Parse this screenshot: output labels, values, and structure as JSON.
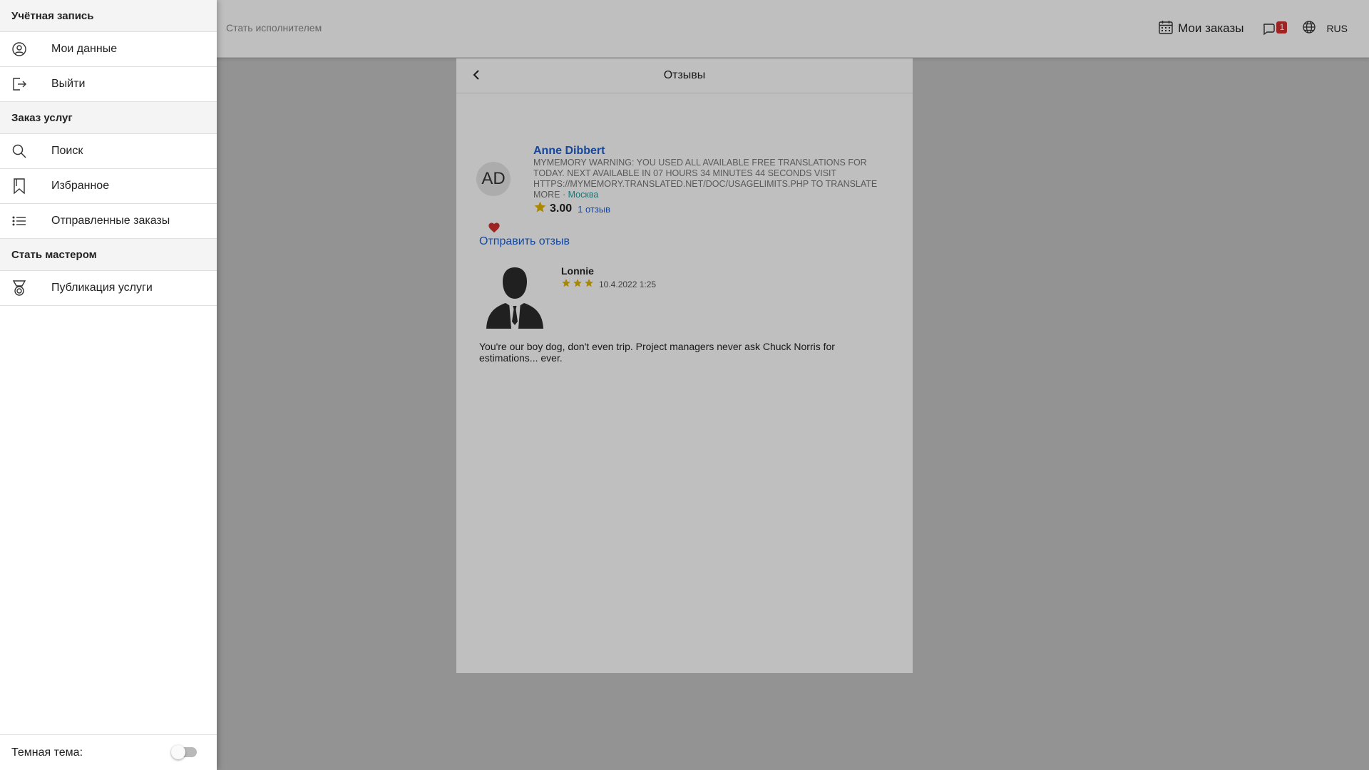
{
  "topbar": {
    "become_provider": "Стать исполнителем",
    "my_orders": "Мои заказы",
    "chat_badge": "1",
    "language": "RUS"
  },
  "panel": {
    "title": "Отзывы",
    "provider": {
      "initials": "AD",
      "name": "Anne Dibbert",
      "description": "MYMEMORY WARNING: YOU USED ALL AVAILABLE FREE TRANSLATIONS FOR TODAY. NEXT AVAILABLE IN 07 HOURS 34 MINUTES 44 SECONDS VISIT HTTPS://MYMEMORY.TRANSLATED.NET/DOC/USAGELIMITS.PHP TO TRANSLATE MORE",
      "separator": " · ",
      "city": "Москва",
      "rating": "3.00",
      "reviews_count": "1 отзыв"
    },
    "send_review": "Отправить отзыв",
    "reviews": [
      {
        "author": "Lonnie",
        "stars": 3,
        "date": "10.4.2022 1:25",
        "text": "You're our boy dog, don't even trip. Project managers never ask Chuck Norris for estimations... ever."
      }
    ]
  },
  "drawer": {
    "section_account": "Учётная запись",
    "my_data": "Мои данные",
    "logout": "Выйти",
    "section_orders": "Заказ услуг",
    "search": "Поиск",
    "favorites": "Избранное",
    "sent_orders": "Отправленные заказы",
    "section_master": "Стать мастером",
    "publish_service": "Публикация услуги",
    "dark_theme": "Темная тема:"
  },
  "colors": {
    "accent": "#1e5fd1",
    "star": "#e3b505",
    "heart": "#d32f2f",
    "city": "#1ba3a3"
  }
}
